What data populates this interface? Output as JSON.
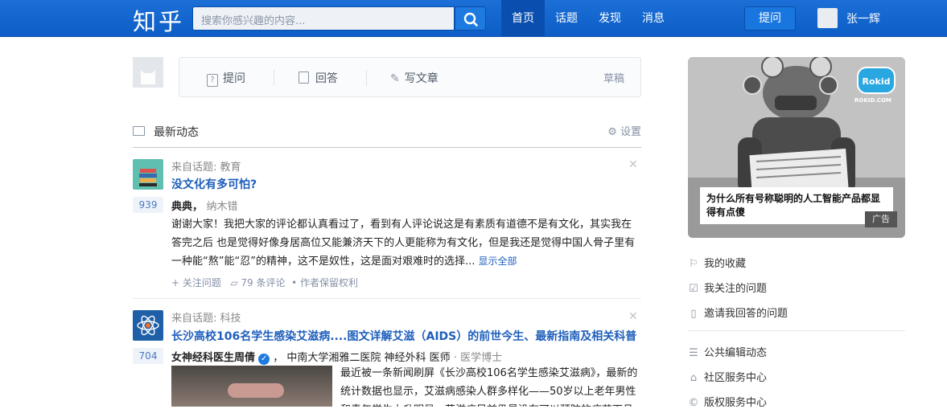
{
  "header": {
    "logo": "知乎",
    "search_placeholder": "搜索你感兴趣的内容...",
    "nav": [
      "首页",
      "话题",
      "发现",
      "消息"
    ],
    "ask_button": "提问",
    "user_name": "张一辉"
  },
  "composer": {
    "ask": "提问",
    "answer": "回答",
    "write": "写文章",
    "drafts": "草稿"
  },
  "feed": {
    "title": "最新动态",
    "settings": "设置",
    "items": [
      {
        "source": "来自话题: 教育",
        "title": "没文化有多可怕?",
        "votes": "939",
        "author": "典典",
        "author_bio": "纳木错",
        "summary": "谢谢大家！我把大家的评论都认真看过了，看到有人评论说这是有素质有道德不是有文化，其实我在答完之后 也是觉得好像身居高位又能兼济天下的人更能称为有文化，但是我还是觉得中国人骨子里有一种能“熬”能“忍”的精神，这不是奴性，这是面对艰难时的选择...",
        "show_all": "显示全部",
        "follow": "+ 关注问题",
        "comments": "79 条评论",
        "rights": "作者保留权利"
      },
      {
        "source": "来自话题: 科技",
        "title": "长沙高校106名学生感染艾滋病....图文详解艾滋（AIDS）的前世今生、最新指南及相关科普",
        "votes": "704",
        "author": "女神经科医生周倩",
        "author_bio": "中南大学湘雅二医院 神经外科 医师",
        "author_degree": "医学博士",
        "summary": "最近被一条新闻刷屏《长沙高校106名学生感染艾滋病》，最新的统计数据也显示，艾滋病感染人群多样化——50岁以上老年男性和青年学生上升明显，艾滋病目前仍是没有可以预防的疫苗下且"
      }
    ]
  },
  "ad": {
    "caption": "为什么所有号称聪明的人工智能产品都显得有点傻",
    "tag": "广告",
    "brand": "Rokid",
    "brand_url": "ROKID.COM"
  },
  "sidebar": {
    "links": [
      "我的收藏",
      "我关注的问题",
      "邀请我回答的问题"
    ],
    "links2": [
      "公共编辑动态",
      "社区服务中心",
      "版权服务中心"
    ]
  }
}
